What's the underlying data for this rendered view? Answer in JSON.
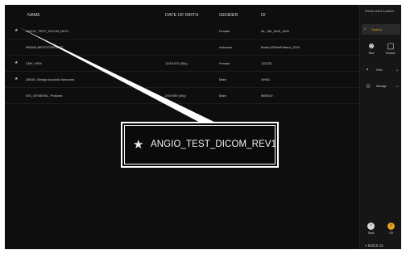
{
  "table": {
    "headers": {
      "name": "NAME",
      "dob": "DATE OF BIRTH",
      "gender": "GENDER",
      "id": "ID"
    },
    "rows": [
      {
        "favorite": true,
        "name": "ANGIO_TEST_DICOM_REV1",
        "dob": "",
        "gender": "Female",
        "id": "NL_AM_KeDi_AVM"
      },
      {
        "favorite": false,
        "name": "BRAINLABTESTPATIENT",
        "dob": "",
        "gender": "unknown",
        "id": "BrainLABTestPatient_1234"
      },
      {
        "favorite": true,
        "name": "CMF_KEM",
        "dob": "11/5/1975 (39y)",
        "gender": "Female",
        "id": "112233"
      },
      {
        "favorite": true,
        "name": "DEMO, Benign Acoustic Neuroma",
        "dob": "",
        "gender": "Male",
        "id": "AHSA"
      },
      {
        "favorite": false,
        "name": "IGS_GENERAL, Prokand",
        "dob": "2/9/1969 (45y)",
        "gender": "Male",
        "id": "M69319"
      }
    ]
  },
  "callout": {
    "star": "★",
    "text": "ANGIO_TEST_DICOM_REV1"
  },
  "sidebar": {
    "title": "Please select a patient",
    "search_label": "Search",
    "search_icon": "⌕",
    "new_label": "New",
    "browse_label": "Browse",
    "filter_label": "Filter",
    "manage_label": "Manage",
    "back_label": "Back",
    "ok_label": "OK",
    "zoom_text": "< 8/3/15 15"
  },
  "colors": {
    "accent": "#e0a020",
    "background": "#0e0e0e"
  }
}
